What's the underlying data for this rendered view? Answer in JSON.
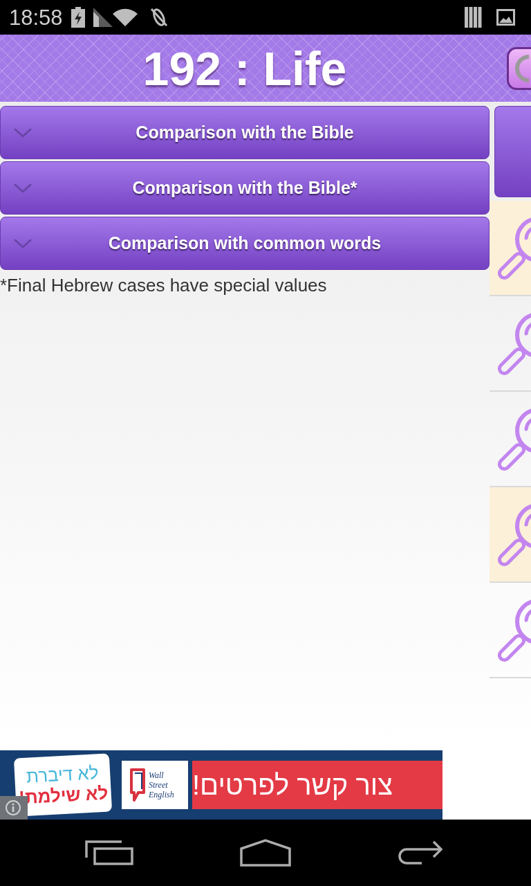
{
  "status_bar": {
    "time": "18:58"
  },
  "header": {
    "title": "192 : Life"
  },
  "accordion": [
    {
      "label": "Comparison with the Bible",
      "expanded": false
    },
    {
      "label": "Comparison with the Bible*",
      "expanded": false
    },
    {
      "label": "Comparison with common words",
      "expanded": false
    }
  ],
  "footnote": "*Final Hebrew cases have special values",
  "side_list": [
    {
      "highlighted": true
    },
    {
      "highlighted": false
    },
    {
      "highlighted": false
    },
    {
      "highlighted": true
    },
    {
      "highlighted": false
    }
  ],
  "ad_banner": {
    "bubble_line_1": "לא דיברת",
    "bubble_line_2": "לא שילמת!",
    "logo_text": "Wall Street English",
    "cta": "צור קשר לפרטים!"
  }
}
